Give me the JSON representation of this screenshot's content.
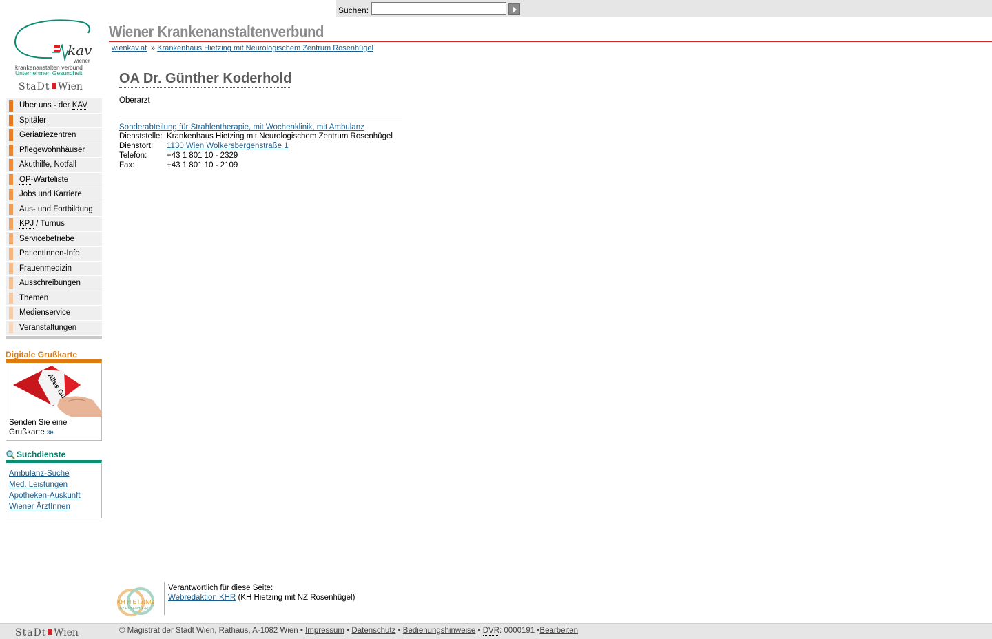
{
  "search": {
    "label": "Suchen:",
    "placeholder": "",
    "value": ""
  },
  "header": {
    "site_title": "Wiener Krankenanstaltenverbund"
  },
  "logo": {
    "brand": "kav",
    "line1": "wiener",
    "line2": "krankenanstalten verbund",
    "line3": "Unternehmen Gesundheit",
    "city": "StaDt Wien"
  },
  "breadcrumb": {
    "home": "wienkav.at",
    "separator": "»",
    "current": "Krankenhaus Hietzing mit Neurologischem Zentrum Rosenhügel"
  },
  "nav": {
    "items": [
      {
        "label_pre": "Über uns - der ",
        "abbr": "KAV",
        "label_post": "",
        "color": "#e8761a"
      },
      {
        "label_pre": "Spitäler",
        "abbr": "",
        "label_post": "",
        "color": "#e8791f"
      },
      {
        "label_pre": "Geriatriezentren",
        "abbr": "",
        "label_post": "",
        "color": "#ea7e26"
      },
      {
        "label_pre": "Pflegewohnhäuser",
        "abbr": "",
        "label_post": "",
        "color": "#ec842e"
      },
      {
        "label_pre": "Akuthilfe, Notfall",
        "abbr": "",
        "label_post": "",
        "color": "#ee8a37"
      },
      {
        "label_pre": "",
        "abbr": "OP",
        "label_post": "-Warteliste",
        "color": "#ef9041"
      },
      {
        "label_pre": "Jobs und Karriere",
        "abbr": "",
        "label_post": "",
        "color": "#f0974b"
      },
      {
        "label_pre": "Aus- und Fortbildung",
        "abbr": "",
        "label_post": "",
        "color": "#f29d56"
      },
      {
        "label_pre": "",
        "abbr": "KPJ",
        "label_post": " / Turnus",
        "color": "#f3a461"
      },
      {
        "label_pre": "Servicebetriebe",
        "abbr": "",
        "label_post": "",
        "color": "#f4ab6d"
      },
      {
        "label_pre": "PatientInnen-Info",
        "abbr": "",
        "label_post": "",
        "color": "#f5b279"
      },
      {
        "label_pre": "Frauenmedizin",
        "abbr": "",
        "label_post": "",
        "color": "#f6b985"
      },
      {
        "label_pre": "Ausschreibungen",
        "abbr": "",
        "label_post": "",
        "color": "#f7c091"
      },
      {
        "label_pre": "Themen",
        "abbr": "",
        "label_post": "",
        "color": "#f8c79d"
      },
      {
        "label_pre": "Medienservice",
        "abbr": "",
        "label_post": "",
        "color": "#f9ceaa"
      },
      {
        "label_pre": "Veranstaltungen",
        "abbr": "",
        "label_post": "",
        "color": "#fad5b6"
      }
    ]
  },
  "greeting_card": {
    "title": "Digitale Grußkarte",
    "card_text": "Alles Gute",
    "text_line1": "Senden Sie eine",
    "text_line2": "Grußkarte",
    "arrow": "»»",
    "accent": "#e07b10"
  },
  "search_services": {
    "title": "Suchdienste",
    "accent": "#0a8f72",
    "links": [
      "Ambulanz-Suche",
      "Med. Leistungen",
      "Apotheken-Auskunft",
      "Wiener ÄrztInnen"
    ]
  },
  "person": {
    "name": "OA Dr. Günther Koderhold",
    "role": "Oberarzt",
    "department": "Sonderabteilung für Strahlentherapie, mit Wochenklinik, mit Ambulanz",
    "contact": [
      {
        "key": "Dienststelle:",
        "value": "Krankenhaus Hietzing mit Neurologischem Zentrum Rosenhügel",
        "link": false
      },
      {
        "key": "Dienstort:",
        "value": "1130 Wien Wolkersbergenstraße 1",
        "link": true
      },
      {
        "key": "Telefon:",
        "value": "+43 1 801 10 - 2329",
        "link": false
      },
      {
        "key": "Fax:",
        "value": "+43 1 801 10 - 2109",
        "link": false
      }
    ]
  },
  "responsible": {
    "logo_line1": "KH HIETZING",
    "logo_line2": "NZ ROSENHÜGEL",
    "heading": "Verantwortlich für diese Seite:",
    "link": "Webredaktion KHR",
    "suffix": "(KH Hietzing mit NZ Rosenhügel)"
  },
  "footer": {
    "city_logo": "StaDt Wien",
    "copyright": "© Magistrat der Stadt Wien, Rathaus, A-1082 Wien •",
    "impressum": "Impressum",
    "bullet": "•",
    "datenschutz": "Datenschutz",
    "bedienung": "Bedienungshinweise",
    "dvr_abbr": "DVR",
    "dvr_value": ": 0000191 •",
    "bearbeiten": "Bearbeiten"
  }
}
